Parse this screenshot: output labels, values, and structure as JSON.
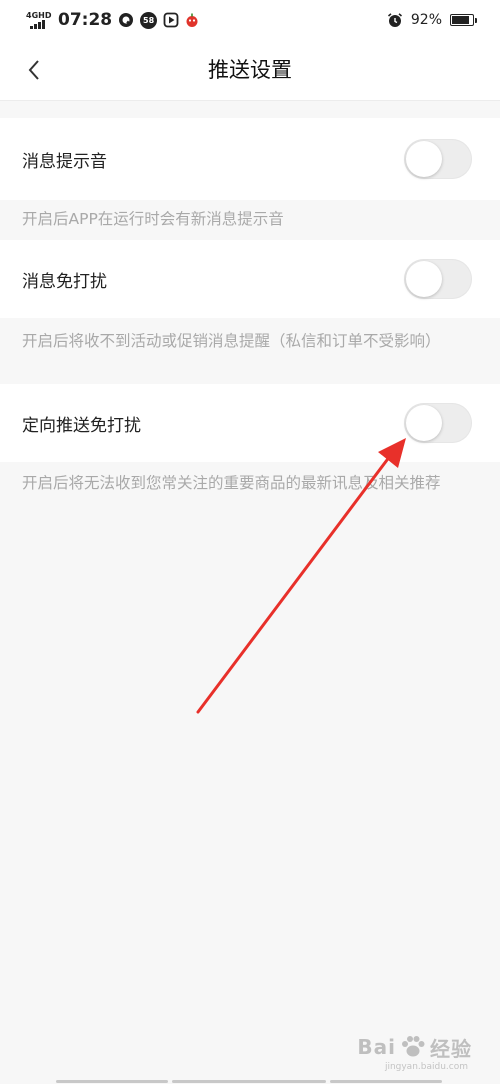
{
  "status_bar": {
    "network": "4GHD",
    "time": "07:28",
    "app_badge": "58",
    "battery_text": "92%",
    "battery_level": 0.92
  },
  "header": {
    "title": "推送设置"
  },
  "settings": [
    {
      "label": "消息提示音",
      "enabled": false,
      "description": "开启后APP在运行时会有新消息提示音"
    },
    {
      "label": "消息免打扰",
      "enabled": false,
      "description": "开启后将收不到活动或促销消息提醒（私信和订单不受影响）"
    },
    {
      "label": "定向推送免打扰",
      "enabled": false,
      "description": "开启后将无法收到您常关注的重要商品的最新讯息及相关推荐"
    }
  ],
  "annotation": {
    "arrow_color": "#e8302a"
  },
  "watermark": {
    "brand": "Bai",
    "brand_suffix": "经验",
    "url": "jingyan.baidu.com"
  },
  "colors": {
    "toggle_off": "#ededed",
    "description_text": "#a9a9a9"
  }
}
